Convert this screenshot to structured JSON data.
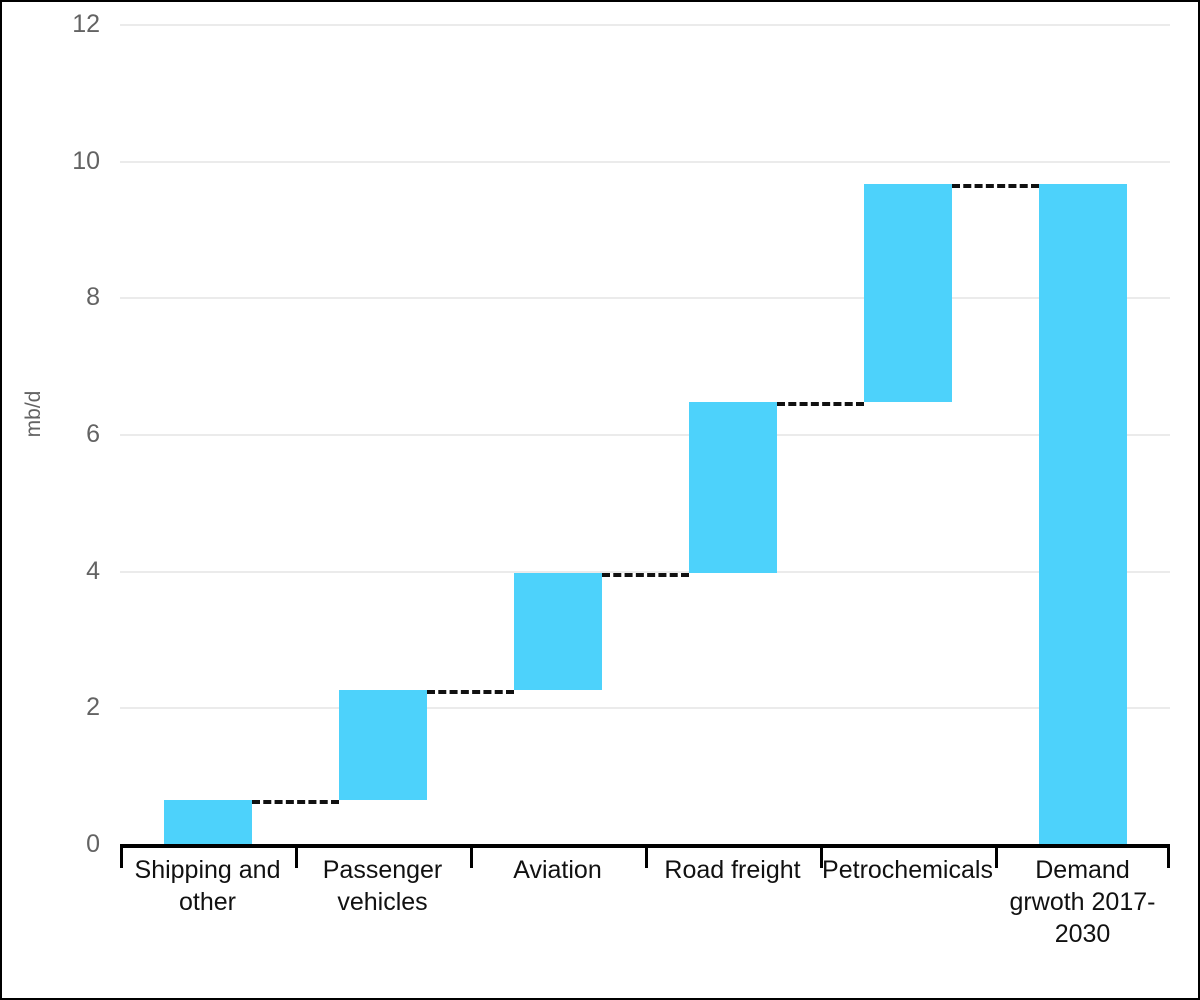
{
  "chart_data": {
    "type": "bar",
    "chart_style": "waterfall",
    "title": "",
    "subtitle": "",
    "xlabel": "",
    "ylabel": "mb/d",
    "ylim": [
      0,
      12
    ],
    "ytick_labels": [
      "0",
      "2",
      "4",
      "6",
      "8",
      "10",
      "12"
    ],
    "ytick_values": [
      0,
      2,
      4,
      6,
      8,
      10,
      12
    ],
    "grid": true,
    "grid_axis": "y",
    "legend": false,
    "legend_position": "none",
    "bar_color": "#4DD2FB",
    "connector_color": "#111111",
    "connector_style": "dashed",
    "gridline_color": "#EBEBEB",
    "axis_color": "#000000",
    "tick_label_color": "#636363",
    "categories": [
      "Shipping and other",
      "Passenger vehicles",
      "Aviation",
      "Road freight",
      "Petrochemicals",
      "Demand grwoth 2017-2030"
    ],
    "values": [
      0.65,
      1.6,
      1.71,
      2.51,
      3.19,
      9.66
    ],
    "bar_bases": [
      0,
      0.65,
      2.25,
      3.96,
      6.47,
      0
    ],
    "bar_tops": [
      0.65,
      2.25,
      3.96,
      6.47,
      9.66,
      9.66
    ],
    "is_total": [
      false,
      false,
      false,
      false,
      false,
      true
    ],
    "connectors": [
      {
        "from_category": "Shipping and other",
        "to_category": "Passenger vehicles",
        "level": 0.65
      },
      {
        "from_category": "Passenger vehicles",
        "to_category": "Aviation",
        "level": 2.25
      },
      {
        "from_category": "Aviation",
        "to_category": "Road freight",
        "level": 3.96
      },
      {
        "from_category": "Road freight",
        "to_category": "Petrochemicals",
        "level": 6.47
      },
      {
        "from_category": "Petrochemicals",
        "to_category": "Demand grwoth 2017-2030",
        "level": 9.66
      }
    ]
  },
  "axis": {
    "y_title": "mb/d",
    "y_ticks": [
      {
        "label": "12",
        "value": 12
      },
      {
        "label": "10",
        "value": 10
      },
      {
        "label": "8",
        "value": 8
      },
      {
        "label": "6",
        "value": 6
      },
      {
        "label": "4",
        "value": 4
      },
      {
        "label": "2",
        "value": 2
      },
      {
        "label": "0",
        "value": 0
      }
    ],
    "x_categories": [
      {
        "label": "Shipping and other"
      },
      {
        "label": "Passenger vehicles"
      },
      {
        "label": "Aviation"
      },
      {
        "label": "Road freight"
      },
      {
        "label": "Petrochemicals"
      },
      {
        "label": "Demand grwoth 2017-2030"
      }
    ]
  }
}
